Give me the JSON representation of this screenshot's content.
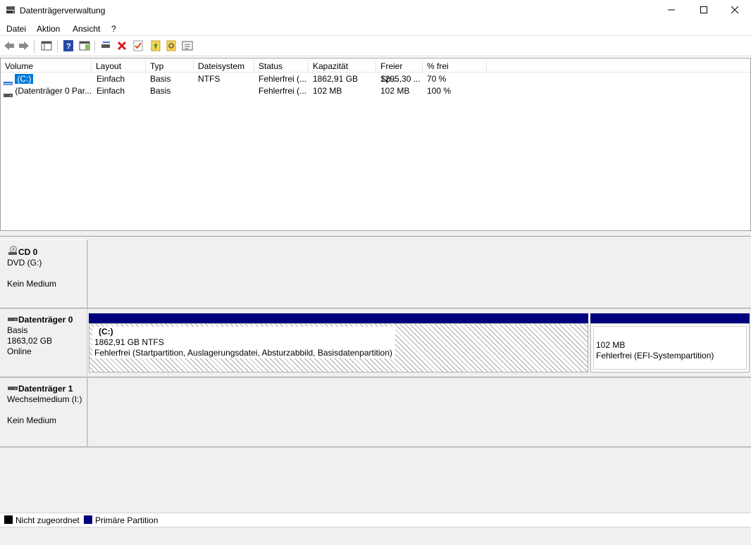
{
  "window": {
    "title": "Datenträgerverwaltung",
    "icon": "disk-management-icon",
    "controls": [
      "minimize-icon",
      "maximize-icon",
      "close-icon"
    ]
  },
  "menu": [
    "Datei",
    "Aktion",
    "Ansicht",
    "?"
  ],
  "toolbar": [
    "back-arrow-icon",
    "forward-arrow-icon",
    "console-tree-icon",
    "help-icon",
    "properties-panel-icon",
    "connect-disk-icon",
    "delete-icon",
    "check-icon",
    "export-icon",
    "search-icon",
    "list-icon"
  ],
  "volume_list": {
    "columns": [
      "Volume",
      "Layout",
      "Typ",
      "Dateisystem",
      "Status",
      "Kapazität",
      "Freier Sp...",
      "% frei"
    ],
    "rows": [
      {
        "volume": "(C:)",
        "layout": "Einfach",
        "typ": "Basis",
        "dateisystem": "NTFS",
        "status": "Fehlerfrei (...",
        "kapazitaet": "1862,91 GB",
        "frei": "1295,30 ...",
        "prozent": "70 %",
        "selected": true
      },
      {
        "volume": "(Datenträger 0 Par...",
        "layout": "Einfach",
        "typ": "Basis",
        "dateisystem": "",
        "status": "Fehlerfrei (...",
        "kapazitaet": "102 MB",
        "frei": "102 MB",
        "prozent": "100 %",
        "selected": false
      }
    ]
  },
  "disks": [
    {
      "name": "CD 0",
      "line1": "DVD (G:)",
      "line2": "",
      "line3": "Kein Medium",
      "icon": "cd-drive-icon"
    },
    {
      "name": "Datenträger 0",
      "line1": "Basis",
      "line2": "1863,02 GB",
      "line3": "Online",
      "icon": "hard-disk-icon",
      "partitions": [
        {
          "title": "(C:)",
          "size": "1862,91 GB NTFS",
          "status": "Fehlerfrei (Startpartition, Auslagerungsdatei, Absturzabbild, Basisdatenpartition)"
        },
        {
          "title": "",
          "size": "102 MB",
          "status": "Fehlerfrei (EFI-Systempartition)"
        }
      ]
    },
    {
      "name": "Datenträger 1",
      "line1": "Wechselmedium (I:)",
      "line2": "",
      "line3": "Kein Medium",
      "icon": "removable-disk-icon"
    }
  ],
  "legend": [
    {
      "label": "Nicht zugeordnet",
      "color": "#000000"
    },
    {
      "label": "Primäre Partition",
      "color": "#00007f"
    }
  ]
}
